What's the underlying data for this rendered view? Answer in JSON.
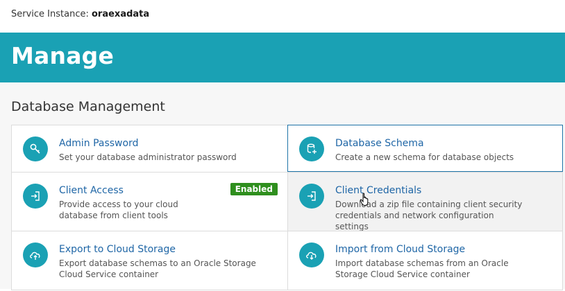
{
  "header": {
    "instance_label": "Service Instance:",
    "instance_name": "oraexadata"
  },
  "hero": {
    "title": "Manage"
  },
  "section": {
    "title": "Database Management"
  },
  "tiles": [
    {
      "title": "Admin Password",
      "desc": "Set your database administrator password",
      "icon": "key-icon"
    },
    {
      "title": "Database Schema",
      "desc": "Create a new schema for database objects",
      "icon": "database-add-icon"
    },
    {
      "title": "Client Access",
      "desc": "Provide access to your cloud database from client tools",
      "badge": "Enabled",
      "icon": "login-icon"
    },
    {
      "title": "Client Credentials",
      "desc": "Download a zip file containing client security credentials and network configuration settings",
      "icon": "login-icon"
    },
    {
      "title": "Export to Cloud Storage",
      "desc": "Export database schemas to an Oracle Storage Cloud Service container",
      "icon": "cloud-upload-icon"
    },
    {
      "title": "Import from Cloud Storage",
      "desc": "Import database schemas from an Oracle Storage Cloud Service container",
      "icon": "cloud-download-icon"
    }
  ],
  "colors": {
    "accent": "#1aa1b4",
    "link": "#1f66a6",
    "badge": "#2f8f1e",
    "selected_border": "#1f74a8"
  }
}
